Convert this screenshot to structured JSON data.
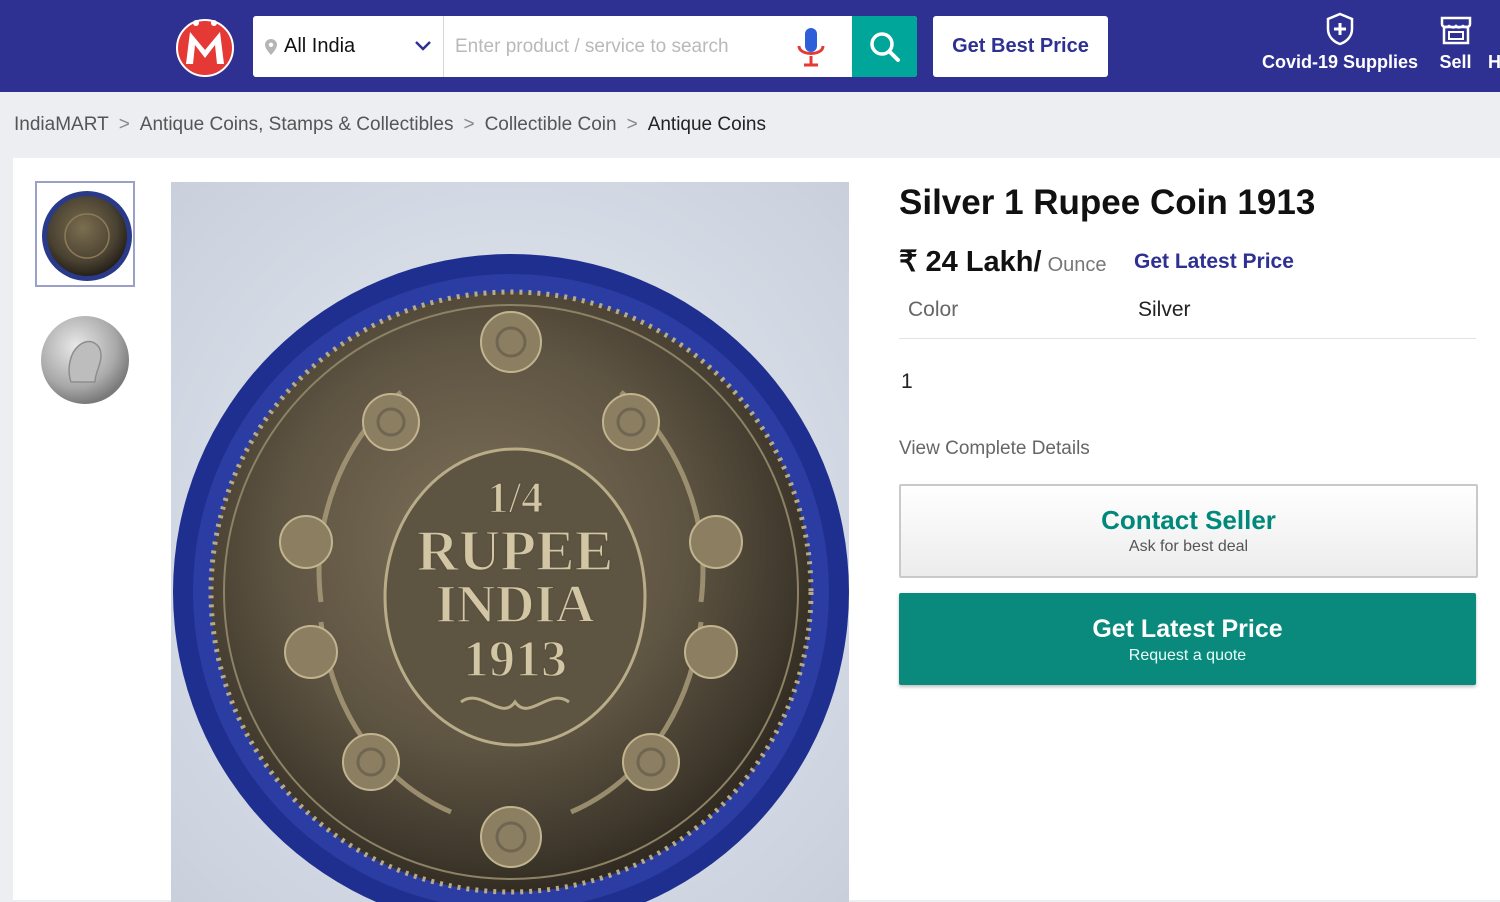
{
  "header": {
    "logo_letter": "M",
    "location": "All India",
    "search_placeholder": "Enter product / service to search",
    "get_best_price": "Get Best Price",
    "covid_label": "Covid-19 Supplies",
    "sell_label": "Sell",
    "cutoff_label": "H"
  },
  "breadcrumb": [
    "IndiaMART",
    "Antique Coins, Stamps & Collectibles",
    "Collectible Coin",
    "Antique Coins"
  ],
  "product": {
    "title": "Silver 1 Rupee Coin 1913",
    "price": "₹ 24 Lakh/",
    "price_unit": "Ounce",
    "latest_price_link": "Get Latest Price",
    "spec_label": "Color",
    "spec_value": "Silver",
    "quantity": "1",
    "view_details": "View Complete Details",
    "contact_button": "Contact Seller",
    "contact_sub": "Ask for best deal",
    "price_button": "Get Latest Price",
    "price_sub": "Request a quote",
    "coin_text": [
      "1/4",
      "RUPEE",
      "INDIA",
      "1913"
    ]
  },
  "icons": {
    "location": "map-pin-icon",
    "dropdown": "chevron-down-icon",
    "mic": "microphone-icon",
    "search": "search-icon",
    "covid": "shield-plus-icon",
    "sell": "store-icon"
  },
  "colors": {
    "brand_blue": "#2e3192",
    "teal": "#00a699",
    "button_teal": "#0a8a7c",
    "logo_red": "#e53935"
  }
}
